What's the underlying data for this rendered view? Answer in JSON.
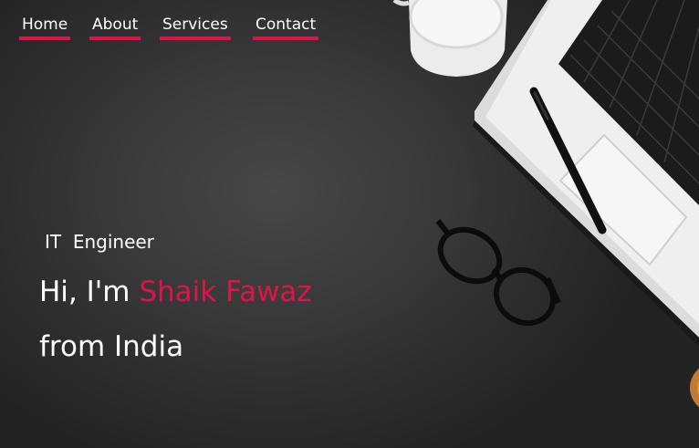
{
  "nav": {
    "items": [
      {
        "label": "Home"
      },
      {
        "label": "About"
      },
      {
        "label": "Services"
      },
      {
        "label": "Contact"
      }
    ]
  },
  "hero": {
    "subtitle": "IT  Engineer",
    "greeting_prefix": "Hi, I'm ",
    "name": "Shaik Fawaz",
    "location_line": "from India"
  },
  "colors": {
    "accent": "#e0124c",
    "background": "#2f2f2f",
    "text": "#ffffff"
  },
  "decor": {
    "objects": [
      "coffee-mug",
      "laptop",
      "pen",
      "eyeglasses",
      "wooden-coaster"
    ]
  }
}
